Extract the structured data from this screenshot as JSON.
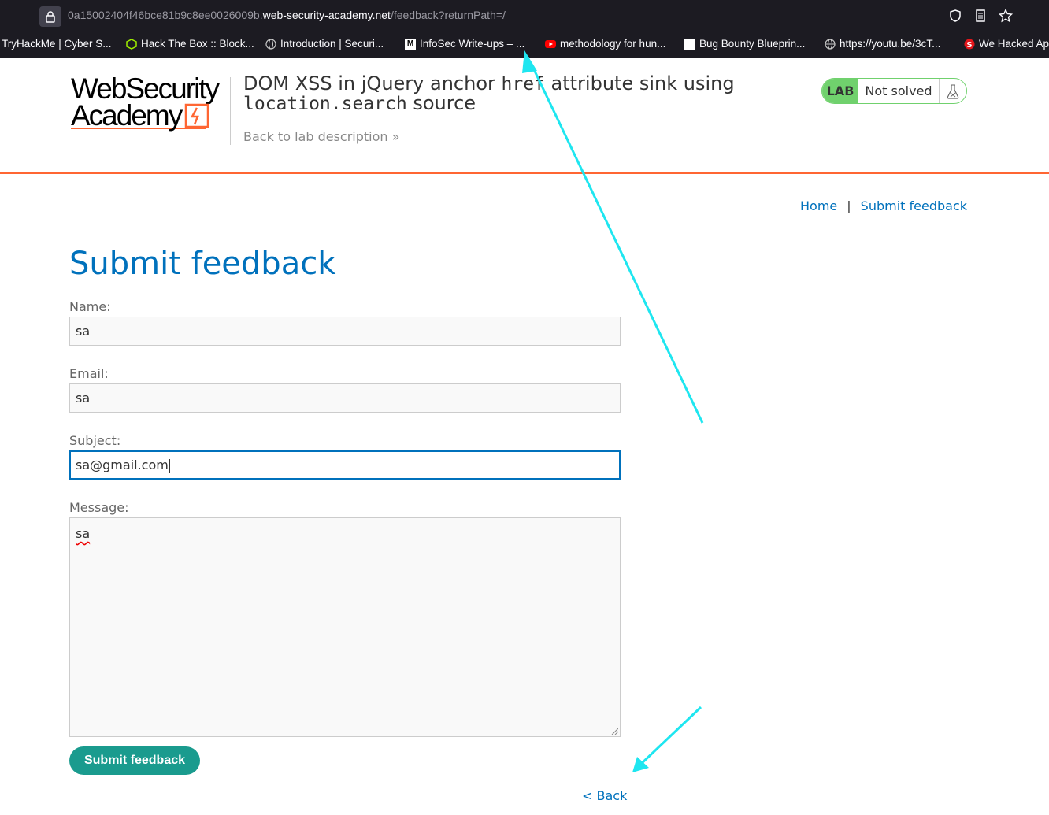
{
  "browser": {
    "url_prefix": "0a15002404f46bce81b9c8ee0026009b.",
    "url_host": "web-security-academy.net",
    "url_path": "/feedback?returnPath=/",
    "bookmarks": [
      {
        "label": "TryHackMe | Cyber S...",
        "icon": "none"
      },
      {
        "label": "Hack The Box :: Block...",
        "icon": "htb-cube-icon"
      },
      {
        "label": "Introduction | Securi...",
        "icon": "globe-icon"
      },
      {
        "label": "InfoSec Write-ups – ...",
        "icon": "medium-icon"
      },
      {
        "label": "methodology for hun...",
        "icon": "youtube-icon"
      },
      {
        "label": "Bug Bounty Blueprin...",
        "icon": "page-icon"
      },
      {
        "label": "https://youtu.be/3cT...",
        "icon": "globe-icon"
      },
      {
        "label": "We Hacked Ap",
        "icon": "red-logo-icon"
      }
    ]
  },
  "header": {
    "logo_line1": "WebSecurity",
    "logo_line2": "Academy",
    "title_part1": "DOM XSS in jQuery anchor ",
    "title_code1": "href",
    "title_part2": " attribute sink using",
    "title_code2": "location.search",
    "title_part3": " source",
    "back_to_description": "Back to lab description",
    "lab_badge": "LAB",
    "lab_status": "Not solved"
  },
  "nav": {
    "home": "Home",
    "separator": "|",
    "submit_feedback": "Submit feedback"
  },
  "main": {
    "title": "Submit feedback",
    "name_label": "Name:",
    "name_value": "sa",
    "email_label": "Email:",
    "email_value": "sa",
    "subject_label": "Subject:",
    "subject_value": "sa@gmail.com",
    "message_label": "Message:",
    "message_value": "sa",
    "submit_label": "Submit feedback",
    "back_label": "< Back"
  },
  "colors": {
    "accent_blue": "#0071bc",
    "orange": "#ff6633",
    "button_green": "#1a9b8e",
    "lab_green": "#70d16d",
    "annotation_cyan": "#1ee6f0"
  }
}
